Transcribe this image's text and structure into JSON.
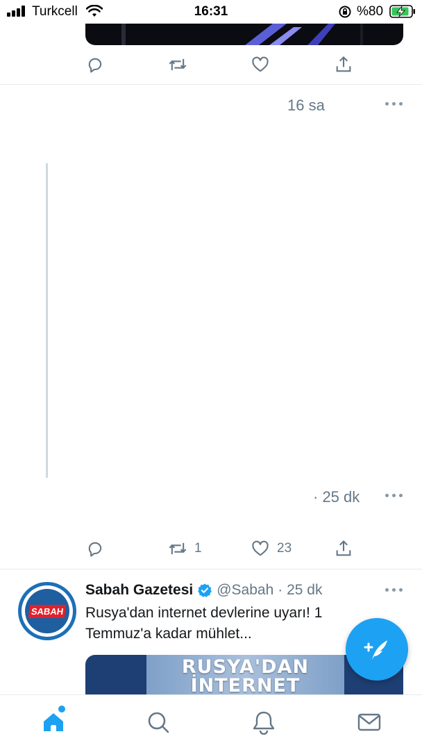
{
  "status_bar": {
    "carrier": "Turkcell",
    "time": "16:31",
    "battery_percent": "%80",
    "icons": [
      "signal-icon",
      "wifi-icon",
      "orientation-lock-icon",
      "battery-charging-icon"
    ]
  },
  "colors": {
    "accent": "#1da1f2",
    "text_primary": "#14171a",
    "text_secondary": "#657786",
    "divider": "#e6ecf0",
    "like_icon": "#657786"
  },
  "timeline": {
    "tweet_top": {
      "actions": [
        "reply-icon",
        "retweet-icon",
        "like-icon",
        "share-icon"
      ]
    },
    "tweet_hidden": {
      "time": "16 sa"
    },
    "tweet_reply": {
      "time": "· 25 dk",
      "retweet_count": "1",
      "like_count": "23",
      "actions": [
        "reply-icon",
        "retweet-icon",
        "like-icon",
        "share-icon"
      ]
    },
    "tweet_sabah": {
      "author_name": "Sabah Gazetesi",
      "verified": true,
      "handle": "@Sabah",
      "time": "· 25 dk",
      "avatar_logo_text": "SABAH",
      "text": "Rusya'dan internet devlerine uyarı! 1 Temmuz'a kadar mühlet...",
      "media_text_line1": "RUSYA'DAN",
      "media_text_line2": "İNTERNET"
    }
  },
  "compose_button": {
    "icon": "compose-tweet-icon"
  },
  "tab_bar": {
    "tabs": [
      "home-icon",
      "search-icon",
      "notifications-icon",
      "messages-icon"
    ],
    "active": "home"
  }
}
